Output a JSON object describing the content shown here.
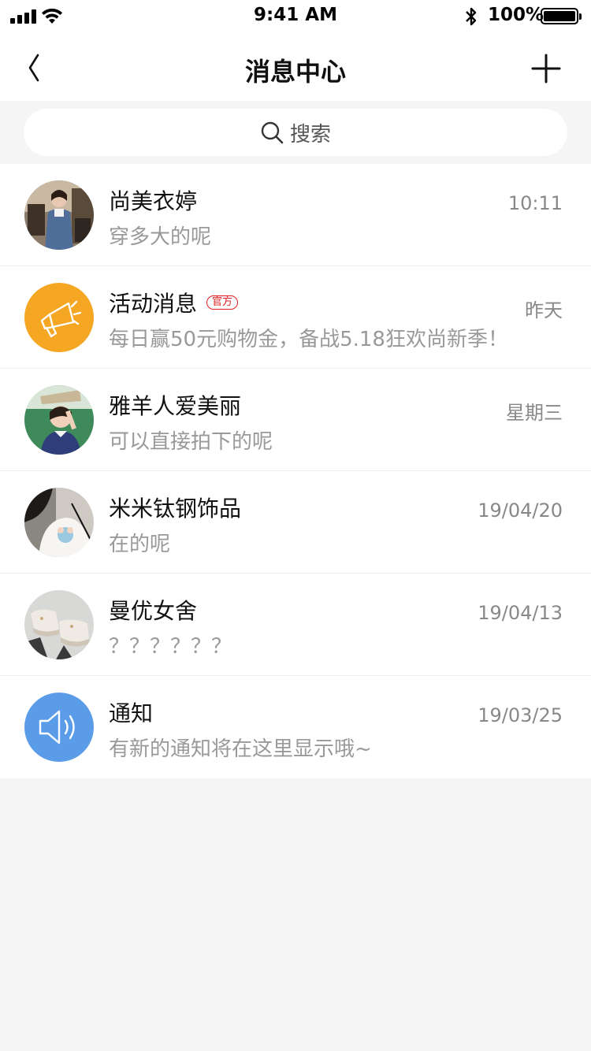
{
  "status_bar": {
    "time": "9:41 AM",
    "battery_text": "100%",
    "battery_level": 1.0
  },
  "nav": {
    "title": "消息中心",
    "back_icon": "chevron-left-icon",
    "add_icon": "plus-icon"
  },
  "search": {
    "placeholder": "搜索",
    "icon": "search-icon"
  },
  "messages": [
    {
      "name": "尚美衣婷",
      "preview": "穿多大的呢",
      "time": "10:11",
      "avatar": "photo-avatar"
    },
    {
      "name": "活动消息",
      "badge": "官方",
      "preview": "每日赢50元购物金，备战5.18狂欢尚新季！",
      "time": "昨天",
      "avatar": "megaphone-icon",
      "avatar_color": "#f5a623"
    },
    {
      "name": "雅羊人爱美丽",
      "preview": "可以直接拍下的呢",
      "time": "星期三",
      "avatar": "photo-avatar"
    },
    {
      "name": "米米钛钢饰品",
      "preview": "在的呢",
      "time": "19/04/20",
      "avatar": "photo-avatar"
    },
    {
      "name": "曼优女舍",
      "preview": "？？？？？？",
      "time": "19/04/13",
      "avatar": "photo-avatar"
    },
    {
      "name": "通知",
      "preview": "有新的通知将在这里显示哦~",
      "time": "19/03/25",
      "avatar": "speaker-icon",
      "avatar_color": "#5b9ce8"
    }
  ],
  "colors": {
    "official_badge": "#e02020",
    "background": "#f5f5f5"
  }
}
